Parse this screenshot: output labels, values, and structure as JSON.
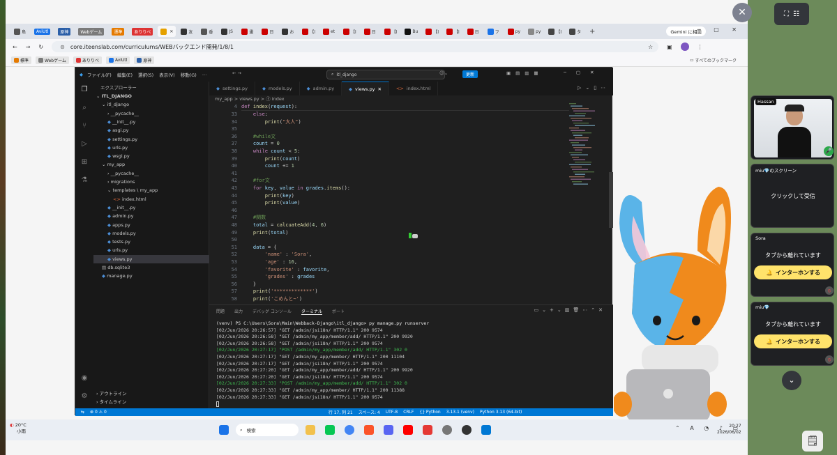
{
  "browser": {
    "tabs": [
      {
        "label": "島",
        "color": "#555"
      },
      {
        "label": "AviUtl",
        "chip": true,
        "color": "#1a73e8"
      },
      {
        "label": "原神",
        "chip": true,
        "color": "#2b5fa8"
      },
      {
        "label": "Webゲーム",
        "chip": true,
        "color": "#7a7a7a"
      },
      {
        "label": "漂準",
        "chip": true,
        "color": "#e57a00"
      },
      {
        "label": "ありりべ",
        "chip": true,
        "color": "#d33"
      },
      {
        "label": "",
        "active": true,
        "color": "#e5a100"
      },
      {
        "label": "友",
        "color": "#333"
      },
      {
        "label": "香",
        "color": "#555"
      },
      {
        "label": "JS",
        "color": "#333"
      },
      {
        "label": "畫",
        "color": "#c00"
      },
      {
        "label": "日",
        "color": "#c00"
      },
      {
        "label": "お",
        "color": "#333"
      },
      {
        "label": "【l",
        "color": "#c00"
      },
      {
        "label": "et",
        "color": "#c00"
      },
      {
        "label": "【l",
        "color": "#c00"
      },
      {
        "label": "日",
        "color": "#c00"
      },
      {
        "label": "【l",
        "color": "#c00"
      },
      {
        "label": "Bu",
        "color": "#111"
      },
      {
        "label": "【l",
        "color": "#c00"
      },
      {
        "label": "【l",
        "color": "#c00"
      },
      {
        "label": "日",
        "color": "#c00"
      },
      {
        "label": "フ",
        "color": "#1a73e8"
      },
      {
        "label": "py",
        "color": "#c00"
      },
      {
        "label": "py",
        "color": "#888"
      },
      {
        "label": "【l",
        "color": "#444"
      },
      {
        "label": "タ",
        "color": "#444"
      }
    ],
    "new_tab": "+",
    "gemini": "Gemini に相談",
    "url": "core.iteenslab.com/curriculums/WEBバックエンド開発/1/8/1",
    "bookmarks": [
      {
        "label": "標準",
        "color": "#e57a00"
      },
      {
        "label": "Webゲーム",
        "color": "#7a7a7a"
      },
      {
        "label": "ありりべ",
        "color": "#d33"
      },
      {
        "label": "AviUtl",
        "color": "#1a73e8"
      },
      {
        "label": "原神",
        "color": "#2b5fa8"
      }
    ],
    "bookmarks_all": "すべてのブックマーク"
  },
  "vscode": {
    "menu": [
      "ファイル(F)",
      "編集(E)",
      "選択(S)",
      "表示(V)",
      "移動(G)",
      "…"
    ],
    "search": "itl_django",
    "update": "更新",
    "explorer_title": "エクスプローラー",
    "tree": [
      {
        "label": "ITL_DJANGO",
        "indent": 0,
        "type": "root"
      },
      {
        "label": "itl_django",
        "indent": 1,
        "type": "folder"
      },
      {
        "label": "__pycache__",
        "indent": 2,
        "type": "folder-closed"
      },
      {
        "label": "__init__.py",
        "indent": 2,
        "type": "py"
      },
      {
        "label": "asgi.py",
        "indent": 2,
        "type": "py"
      },
      {
        "label": "settings.py",
        "indent": 2,
        "type": "py"
      },
      {
        "label": "urls.py",
        "indent": 2,
        "type": "py"
      },
      {
        "label": "wsgi.py",
        "indent": 2,
        "type": "py"
      },
      {
        "label": "my_app",
        "indent": 1,
        "type": "folder"
      },
      {
        "label": "__pycache__",
        "indent": 2,
        "type": "folder-closed"
      },
      {
        "label": "migrations",
        "indent": 2,
        "type": "folder-closed"
      },
      {
        "label": "templates \\ my_app",
        "indent": 2,
        "type": "folder"
      },
      {
        "label": "index.html",
        "indent": 3,
        "type": "html"
      },
      {
        "label": "__init__.py",
        "indent": 2,
        "type": "py"
      },
      {
        "label": "admin.py",
        "indent": 2,
        "type": "py"
      },
      {
        "label": "apps.py",
        "indent": 2,
        "type": "py"
      },
      {
        "label": "models.py",
        "indent": 2,
        "type": "py"
      },
      {
        "label": "tests.py",
        "indent": 2,
        "type": "py"
      },
      {
        "label": "urls.py",
        "indent": 2,
        "type": "py"
      },
      {
        "label": "views.py",
        "indent": 2,
        "type": "py",
        "selected": true
      },
      {
        "label": "db.sqlite3",
        "indent": 1,
        "type": "db"
      },
      {
        "label": "manage.py",
        "indent": 1,
        "type": "py"
      }
    ],
    "outline": "アウトライン",
    "timeline": "タイムライン",
    "editor_tabs": [
      {
        "label": "settings.py"
      },
      {
        "label": "models.py"
      },
      {
        "label": "admin.py"
      },
      {
        "label": "views.py",
        "active": true
      },
      {
        "label": "index.html",
        "html": true
      }
    ],
    "breadcrumb": "my_app  >  views.py  >  ⓕ index",
    "sticky": {
      "ln": "4",
      "text": "def index(request):"
    },
    "lines": [
      {
        "ln": "33",
        "text": "    else:"
      },
      {
        "ln": "34",
        "text": "        print(\"大人\")"
      },
      {
        "ln": "35",
        "text": ""
      },
      {
        "ln": "36",
        "text": "    #while文"
      },
      {
        "ln": "37",
        "text": "    count = 0"
      },
      {
        "ln": "38",
        "text": "    while count < 5:"
      },
      {
        "ln": "39",
        "text": "        print(count)"
      },
      {
        "ln": "40",
        "text": "        count += 1"
      },
      {
        "ln": "41",
        "text": ""
      },
      {
        "ln": "42",
        "text": "    #for文"
      },
      {
        "ln": "43",
        "text": "    for key, value in grades.items():"
      },
      {
        "ln": "44",
        "text": "        print(key)"
      },
      {
        "ln": "45",
        "text": "        print(value)"
      },
      {
        "ln": "46",
        "text": ""
      },
      {
        "ln": "47",
        "text": "    #関数"
      },
      {
        "ln": "48",
        "text": "    total = calcuateAdd(4, 6)"
      },
      {
        "ln": "49",
        "text": "    print(total)"
      },
      {
        "ln": "50",
        "text": ""
      },
      {
        "ln": "51",
        "text": "    data = {"
      },
      {
        "ln": "52",
        "text": "        'name' : 'Sora',"
      },
      {
        "ln": "53",
        "text": "        'age' : 16,"
      },
      {
        "ln": "54",
        "text": "        'favorite' : favorite,"
      },
      {
        "ln": "55",
        "text": "        'grades' : grades"
      },
      {
        "ln": "56",
        "text": "    }"
      },
      {
        "ln": "57",
        "text": "    print('*************')"
      },
      {
        "ln": "58",
        "text": "    print('こめんと~')"
      }
    ],
    "panel_tabs": [
      "問題",
      "出力",
      "デバッグ コンソール",
      "ターミナル",
      "ポート"
    ],
    "panel_active": 3,
    "terminal": [
      {
        "text": "(venv) PS C:\\Users\\Sora\\Main\\Webback-Django\\itl_django> py manage.py runserver",
        "kind": "prompt"
      },
      {
        "text": "[02/Jun/2026 20:26:57] \"GET /admin/jsi18n/ HTTP/1.1\" 200 9574",
        "kind": "plain"
      },
      {
        "text": "[02/Jun/2026 20:26:58] \"GET /admin/my_app/member/add/ HTTP/1.1\" 200 9920",
        "kind": "plain"
      },
      {
        "text": "[02/Jun/2026 20:26:58] \"GET /admin/jsi18n/ HTTP/1.1\" 200 9574",
        "kind": "plain"
      },
      {
        "text": "[02/Jun/2026 20:27:17] \"POST /admin/my_app/member/add/ HTTP/1.1\" 302 0",
        "kind": "post"
      },
      {
        "text": "[02/Jun/2026 20:27:17] \"GET /admin/my_app/member/ HTTP/1.1\" 200 11104",
        "kind": "plain"
      },
      {
        "text": "[02/Jun/2026 20:27:17] \"GET /admin/jsi18n/ HTTP/1.1\" 200 9574",
        "kind": "plain"
      },
      {
        "text": "[02/Jun/2026 20:27:20] \"GET /admin/my_app/member/add/ HTTP/1.1\" 200 9920",
        "kind": "plain"
      },
      {
        "text": "[02/Jun/2026 20:27:20] \"GET /admin/jsi18n/ HTTP/1.1\" 200 9574",
        "kind": "plain"
      },
      {
        "text": "[02/Jun/2026 20:27:33] \"POST /admin/my_app/member/add/ HTTP/1.1\" 302 0",
        "kind": "post"
      },
      {
        "text": "[02/Jun/2026 20:27:33] \"GET /admin/my_app/member/ HTTP/1.1\" 200 11388",
        "kind": "plain"
      },
      {
        "text": "[02/Jun/2026 20:27:33] \"GET /admin/jsi18n/ HTTP/1.1\" 200 9574",
        "kind": "plain"
      }
    ],
    "status": [
      "⊗ 0 ⚠ 0",
      "行 17, 列 21",
      "スペース: 4",
      "UTF-8",
      "CRLF",
      "{} Python",
      "3.13.1 (venv)",
      "Python 3.13 (64-bit)"
    ]
  },
  "taskbar": {
    "weather_temp": "20°C",
    "weather_desc": "小雨",
    "search": "検索",
    "time": "20:27",
    "date": "2026/06/02",
    "ime": "A"
  },
  "call": {
    "hassan": "Hassan",
    "miu_screen": "miu💎のスクリーン",
    "click_to_receive": "クリックして受信",
    "sora": "Sora",
    "away_text": "タブから離れています",
    "intercom": "インターホンする",
    "miu": "miu💎"
  },
  "colors": {
    "accent": "#0078d4",
    "intercom": "#ffe36b",
    "mascot_blue": "#5ab4e8",
    "mascot_orange": "#f08a1c"
  }
}
